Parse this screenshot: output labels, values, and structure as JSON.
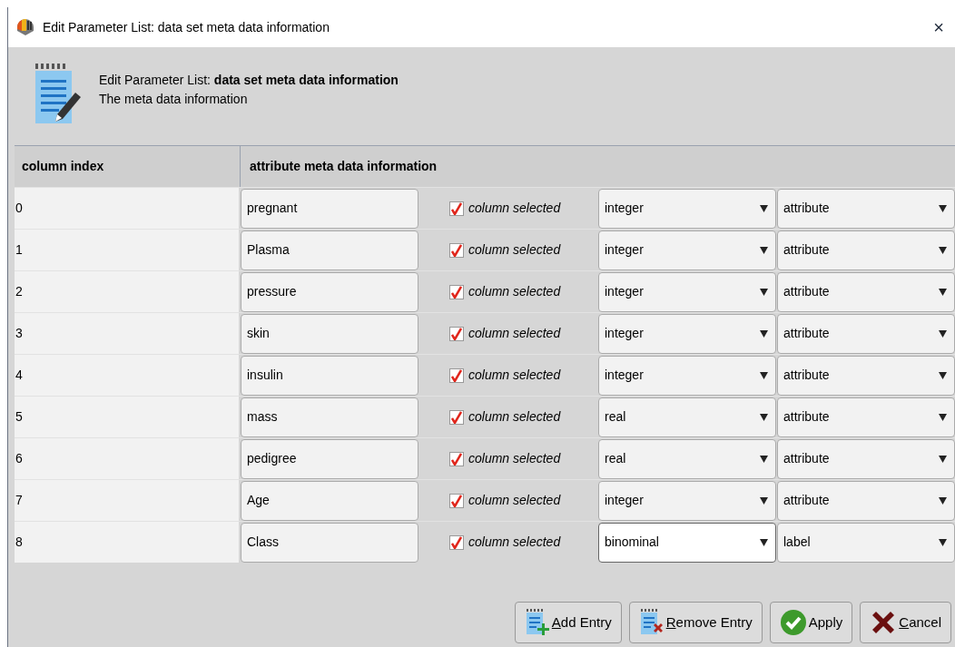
{
  "window": {
    "title": "Edit Parameter List: data set meta data information",
    "close": "×"
  },
  "header": {
    "title": "Edit Parameter List: **data set meta data information**",
    "description": "The meta data information"
  },
  "table": {
    "columns": [
      "column index",
      "attribute meta data information"
    ],
    "rows": [
      {
        "index": "0",
        "name": "pregnant",
        "checked": true,
        "check_label": "column selected",
        "type": "integer",
        "type_focused": false,
        "role": "attribute"
      },
      {
        "index": "1",
        "name": "Plasma",
        "checked": true,
        "check_label": "column selected",
        "type": "integer",
        "type_focused": false,
        "role": "attribute"
      },
      {
        "index": "2",
        "name": "pressure",
        "checked": true,
        "check_label": "column selected",
        "type": "integer",
        "type_focused": false,
        "role": "attribute"
      },
      {
        "index": "3",
        "name": "skin",
        "checked": true,
        "check_label": "column selected",
        "type": "integer",
        "type_focused": false,
        "role": "attribute"
      },
      {
        "index": "4",
        "name": "insulin",
        "checked": true,
        "check_label": "column selected",
        "type": "integer",
        "type_focused": false,
        "role": "attribute"
      },
      {
        "index": "5",
        "name": "mass",
        "checked": true,
        "check_label": "column selected",
        "type": "real",
        "type_focused": false,
        "role": "attribute"
      },
      {
        "index": "6",
        "name": "pedigree",
        "checked": true,
        "check_label": "column selected",
        "type": "real",
        "type_focused": false,
        "role": "attribute"
      },
      {
        "index": "7",
        "name": "Age",
        "checked": true,
        "check_label": "column selected",
        "type": "integer",
        "type_focused": false,
        "role": "attribute"
      },
      {
        "index": "8",
        "name": "Class",
        "checked": true,
        "check_label": "column selected",
        "type": "binominal",
        "type_focused": true,
        "role": "label"
      }
    ]
  },
  "buttons": [
    {
      "kind": "add",
      "label": "Add Entry",
      "mnemonic": true
    },
    {
      "kind": "remove",
      "label": "Remove Entry",
      "mnemonic": true
    },
    {
      "kind": "apply",
      "label": "Apply",
      "mnemonic": false
    },
    {
      "kind": "cancel",
      "label": "Cancel",
      "mnemonic": true
    }
  ]
}
